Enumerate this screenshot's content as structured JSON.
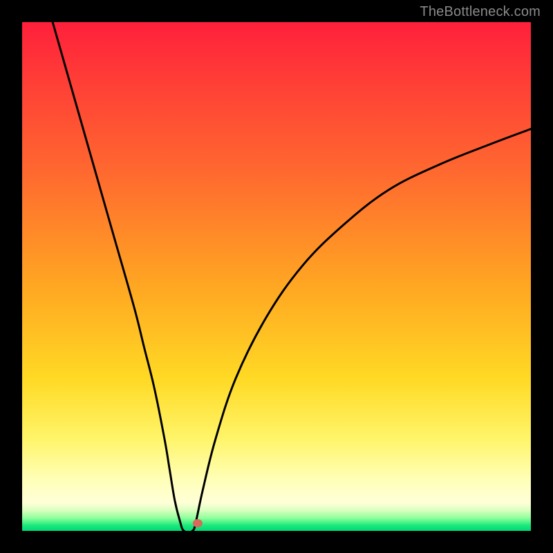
{
  "watermark": {
    "text": "TheBottleneck.com"
  },
  "chart_data": {
    "type": "line",
    "title": "",
    "xlabel": "",
    "ylabel": "",
    "xlim": [
      0,
      100
    ],
    "ylim": [
      0,
      100
    ],
    "grid": false,
    "legend": false,
    "series": [
      {
        "name": "bottleneck-curve",
        "x": [
          6,
          10,
          14,
          18,
          22,
          24,
          26,
          28,
          29,
          30,
          31,
          31.8,
          33.5,
          34.2,
          35.5,
          38,
          42,
          48,
          55,
          63,
          72,
          82,
          92,
          100
        ],
        "values": [
          100,
          86,
          72,
          58,
          44,
          36,
          28,
          18,
          12,
          6,
          2,
          0,
          0,
          2,
          8,
          18,
          30,
          42,
          52,
          60,
          67,
          72,
          76,
          79
        ]
      }
    ],
    "marker": {
      "x": 34.5,
      "y": 1.5,
      "color": "#d86a5a",
      "radius_px": 7
    },
    "background_gradient": {
      "stops": [
        {
          "pct": 0,
          "color": "#ff1f3b"
        },
        {
          "pct": 30,
          "color": "#ff6a2f"
        },
        {
          "pct": 70,
          "color": "#ffd924"
        },
        {
          "pct": 94,
          "color": "#ffffd8"
        },
        {
          "pct": 100,
          "color": "#00d977"
        }
      ]
    }
  }
}
